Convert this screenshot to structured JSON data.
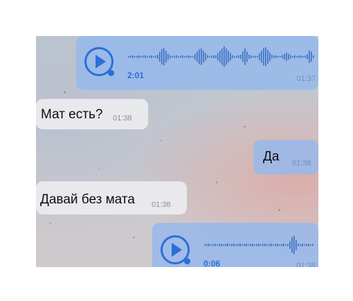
{
  "messages": [
    {
      "type": "voice",
      "direction": "out",
      "duration": "2:01",
      "time": "01:37"
    },
    {
      "type": "text",
      "direction": "in",
      "text": "Мат есть?",
      "time": "01:38"
    },
    {
      "type": "text",
      "direction": "out",
      "text": "Да",
      "time": "01:38"
    },
    {
      "type": "text",
      "direction": "in",
      "text": "Давай без мата",
      "time": "01:38"
    },
    {
      "type": "voice",
      "direction": "out",
      "duration": "0:06",
      "time": "01:38"
    }
  ],
  "colors": {
    "accent": "#2c6fd6",
    "outgoing_bubble": "#96b9eb",
    "incoming_bubble": "#ececf0"
  },
  "icons": [
    "play-icon",
    "waveform"
  ]
}
